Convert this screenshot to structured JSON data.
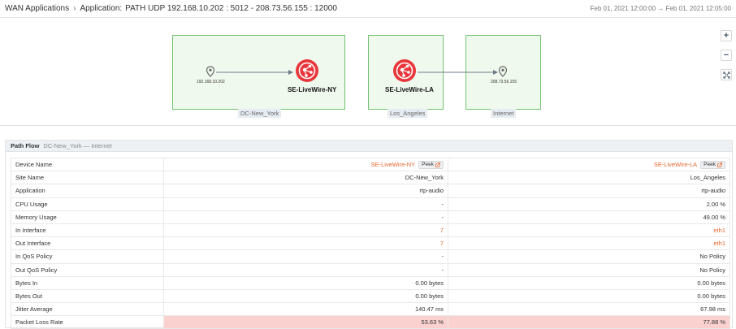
{
  "breadcrumb": {
    "root": "WAN Applications",
    "level1": "Application:",
    "current": "PATH UDP 192.168.10.202 : 5012 - 208.73.56.155 : 12000"
  },
  "time_range": "Feb 01, 2021 12:00:00 → Feb 01, 2021 12:05:00",
  "topology": {
    "groups": [
      {
        "label": "DC-New_York"
      },
      {
        "label": "Los_Angeles"
      },
      {
        "label": "Internet"
      }
    ],
    "endpoints": [
      {
        "label": "192.168.10.202"
      },
      {
        "label": "208.73.56.155"
      }
    ],
    "devices": [
      {
        "label": "SE-LiveWire-NY"
      },
      {
        "label": "SE-LiveWire-LA"
      }
    ],
    "zoom": {
      "plus": "+",
      "minus": "−"
    }
  },
  "path_flow": {
    "title": "Path Flow",
    "subtitle": "DC-New_York — Internet",
    "peek_label": "Peek",
    "rows": [
      {
        "label": "Device Name",
        "a": "SE-LiveWire-NY",
        "b": "SE-LiveWire-LA",
        "kind": "device"
      },
      {
        "label": "Site Name",
        "a": "DC-New_York",
        "b": "Los_Angeles"
      },
      {
        "label": "Application",
        "a": "rtp-audio",
        "b": "rtp-audio"
      },
      {
        "label": "CPU Usage",
        "a": "-",
        "b": "2.00 %"
      },
      {
        "label": "Memory Usage",
        "a": "-",
        "b": "49.00 %"
      },
      {
        "label": "In Interface",
        "a": "7",
        "b": "eth1",
        "kind": "link"
      },
      {
        "label": "Out Interface",
        "a": "7",
        "b": "eth1",
        "kind": "link"
      },
      {
        "label": "In QoS Policy",
        "a": "-",
        "b": "No Policy"
      },
      {
        "label": "Out QoS Policy",
        "a": "-",
        "b": "No Policy"
      },
      {
        "label": "Bytes In",
        "a": "0.00 bytes",
        "b": "0.00 bytes"
      },
      {
        "label": "Bytes Out",
        "a": "0.00 bytes",
        "b": "0.00 bytes"
      },
      {
        "label": "Jitter Average",
        "a": "140.47 ms",
        "b": "67.98 ms"
      },
      {
        "label": "Packet Loss Rate",
        "a": "53.63 %",
        "b": "77.88 %",
        "kind": "alert"
      }
    ]
  },
  "colors": {
    "accent": "#e8662c",
    "device_icon": "#e8373b",
    "group_border": "#6fc46f",
    "alert_bg": "#fad1cf"
  }
}
